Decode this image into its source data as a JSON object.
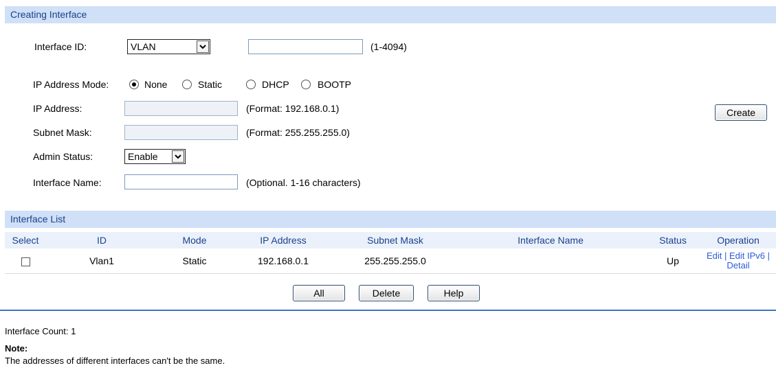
{
  "creating_interface": {
    "header": "Creating Interface",
    "interface_id_label": "Interface ID:",
    "interface_id_select": "VLAN",
    "interface_id_input": "",
    "interface_id_hint": "(1-4094)",
    "ip_mode_label": "IP Address Mode:",
    "ip_mode_options": [
      "None",
      "Static",
      "DHCP",
      "BOOTP"
    ],
    "ip_mode_selected": "None",
    "ip_address_label": "IP Address:",
    "ip_address_value": "",
    "ip_address_hint": "(Format: 192.168.0.1)",
    "subnet_mask_label": "Subnet Mask:",
    "subnet_mask_value": "",
    "subnet_mask_hint": "(Format: 255.255.255.0)",
    "admin_status_label": "Admin Status:",
    "admin_status_value": "Enable",
    "interface_name_label": "Interface Name:",
    "interface_name_value": "",
    "interface_name_hint": "(Optional. 1-16 characters)",
    "create_button": "Create"
  },
  "interface_list": {
    "header": "Interface List",
    "columns": [
      "Select",
      "ID",
      "Mode",
      "IP Address",
      "Subnet Mask",
      "Interface Name",
      "Status",
      "Operation"
    ],
    "rows": [
      {
        "id": "Vlan1",
        "mode": "Static",
        "ip": "192.168.0.1",
        "mask": "255.255.255.0",
        "name": "",
        "status": "Up",
        "op_line1": "Edit | Edit IPv6 |",
        "op_line2": "Detail"
      }
    ],
    "buttons": {
      "all": "All",
      "delete": "Delete",
      "help": "Help"
    }
  },
  "footer": {
    "count": "Interface Count: 1",
    "note_title": "Note:",
    "note_text": "The addresses of different interfaces can't be the same."
  },
  "colors": {
    "header_bg": "#cfe0f7",
    "header_text": "#1b3f8c",
    "link": "#2a5bd7",
    "divider": "#3a74c4"
  }
}
